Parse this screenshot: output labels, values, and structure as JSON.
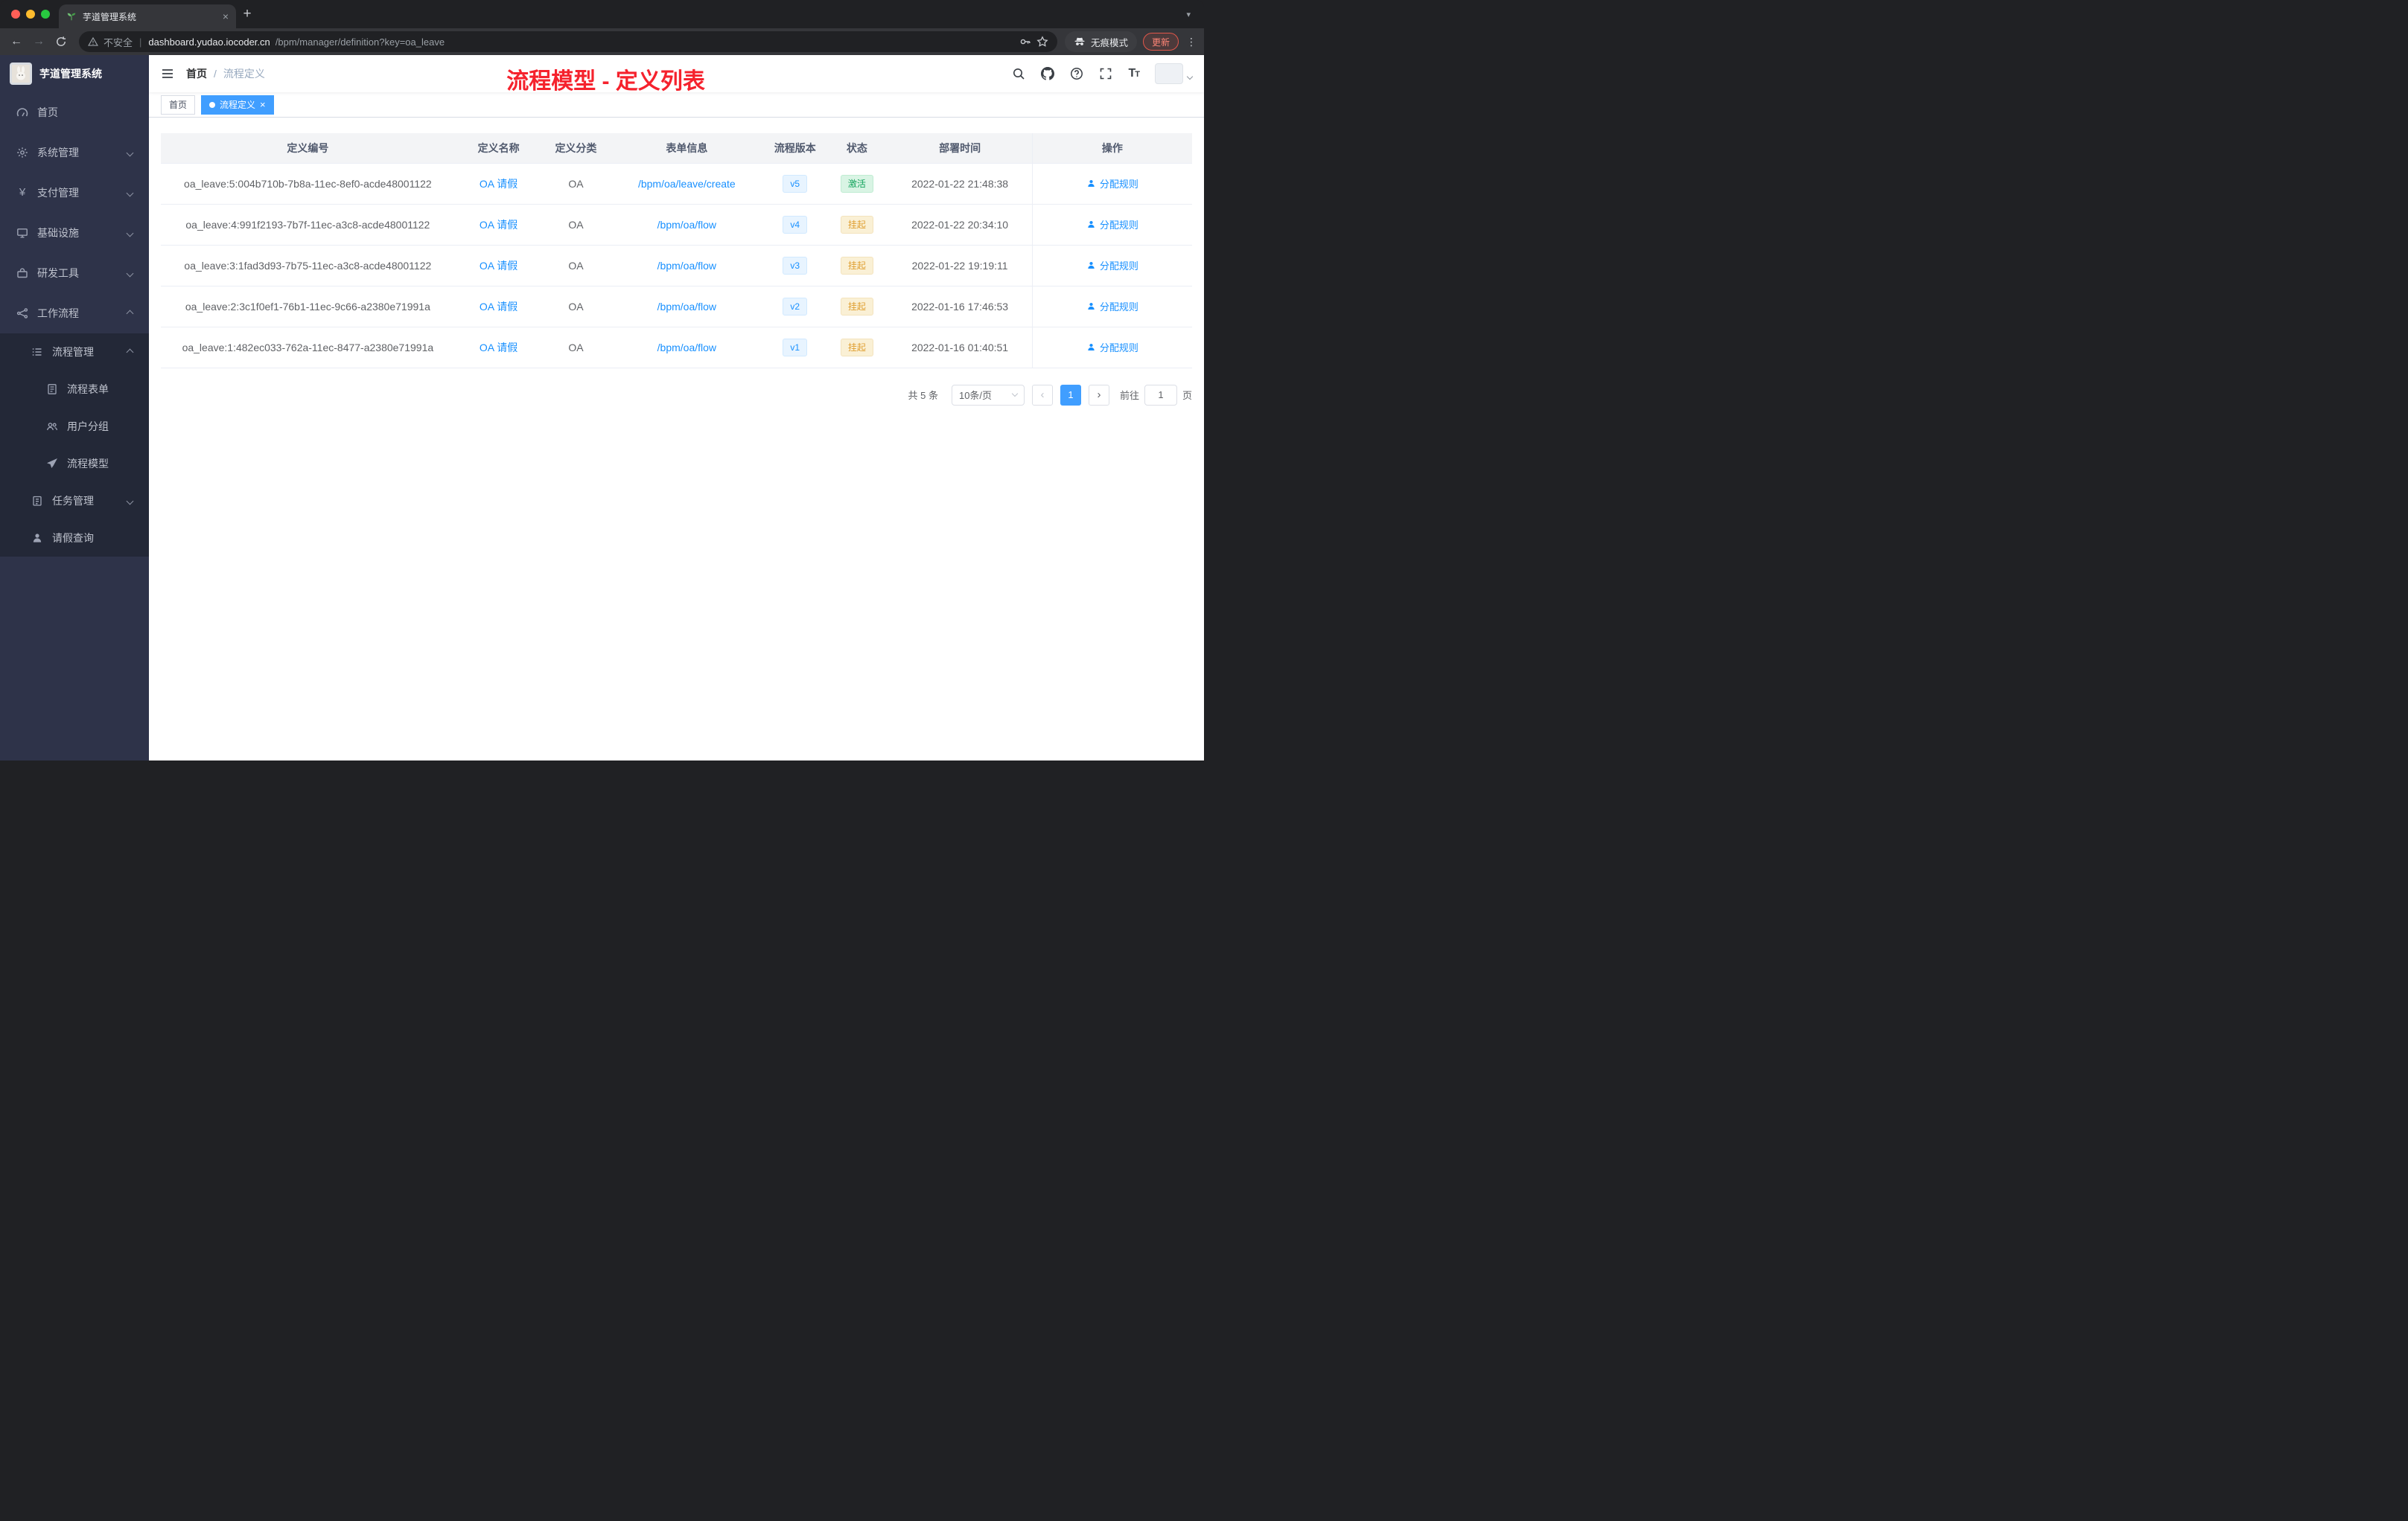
{
  "browser": {
    "tab_title": "芋道管理系统",
    "security_label": "不安全",
    "url_host": "dashboard.yudao.iocoder.cn",
    "url_path": "/bpm/manager/definition?key=oa_leave",
    "incognito_label": "无痕模式",
    "update_label": "更新"
  },
  "sidebar": {
    "title": "芋道管理系统",
    "menu": [
      {
        "label": "首页"
      },
      {
        "label": "系统管理"
      },
      {
        "label": "支付管理"
      },
      {
        "label": "基础设施"
      },
      {
        "label": "研发工具"
      },
      {
        "label": "工作流程"
      },
      {
        "label": "流程管理"
      },
      {
        "label": "流程表单"
      },
      {
        "label": "用户分组"
      },
      {
        "label": "流程模型"
      },
      {
        "label": "任务管理"
      },
      {
        "label": "请假查询"
      }
    ]
  },
  "header": {
    "breadcrumb_home": "首页",
    "breadcrumb_separator": "/",
    "breadcrumb_current": "流程定义",
    "annotation": "流程模型 - 定义列表"
  },
  "tags": {
    "home": "首页",
    "active": "流程定义"
  },
  "table": {
    "columns": [
      "定义编号",
      "定义名称",
      "定义分类",
      "表单信息",
      "流程版本",
      "状态",
      "部署时间",
      "操作"
    ],
    "rows": [
      {
        "id": "oa_leave:5:004b710b-7b8a-11ec-8ef0-acde48001122",
        "name": "OA 请假",
        "category": "OA",
        "form": "/bpm/oa/leave/create",
        "version": "v5",
        "status": "激活",
        "time": "2022-01-22 21:48:38",
        "action": "分配规则"
      },
      {
        "id": "oa_leave:4:991f2193-7b7f-11ec-a3c8-acde48001122",
        "name": "OA 请假",
        "category": "OA",
        "form": "/bpm/oa/flow",
        "version": "v4",
        "status": "挂起",
        "time": "2022-01-22 20:34:10",
        "action": "分配规则"
      },
      {
        "id": "oa_leave:3:1fad3d93-7b75-11ec-a3c8-acde48001122",
        "name": "OA 请假",
        "category": "OA",
        "form": "/bpm/oa/flow",
        "version": "v3",
        "status": "挂起",
        "time": "2022-01-22 19:19:11",
        "action": "分配规则"
      },
      {
        "id": "oa_leave:2:3c1f0ef1-76b1-11ec-9c66-a2380e71991a",
        "name": "OA 请假",
        "category": "OA",
        "form": "/bpm/oa/flow",
        "version": "v2",
        "status": "挂起",
        "time": "2022-01-16 17:46:53",
        "action": "分配规则"
      },
      {
        "id": "oa_leave:1:482ec033-762a-11ec-8477-a2380e71991a",
        "name": "OA 请假",
        "category": "OA",
        "form": "/bpm/oa/flow",
        "version": "v1",
        "status": "挂起",
        "time": "2022-01-16 01:40:51",
        "action": "分配规则"
      }
    ]
  },
  "pagination": {
    "total": "共 5 条",
    "page_size": "10条/页",
    "current_page": "1",
    "goto_label": "前往",
    "goto_value": "1",
    "page_unit": "页"
  },
  "colors": {
    "accent": "#409eff",
    "link": "#1890ff",
    "annotation": "#f5222d",
    "status_active": "#13a45c",
    "status_suspended": "#df9e2f",
    "sidebar_bg": "#2e3349",
    "submenu_bg": "#232837"
  },
  "icons": [
    "leaf-favicon",
    "warning-icon",
    "key-icon",
    "star-icon",
    "incognito-icon",
    "dashboard-icon",
    "gear-icon",
    "yen-icon",
    "infra-icon",
    "dev-tools-icon",
    "workflow-icon",
    "list-icon",
    "form-icon",
    "users-icon",
    "send-icon",
    "task-icon",
    "user-icon",
    "hamburger-icon",
    "search-icon",
    "github-icon",
    "question-icon",
    "fullscreen-icon",
    "font-size-icon",
    "person-icon"
  ]
}
